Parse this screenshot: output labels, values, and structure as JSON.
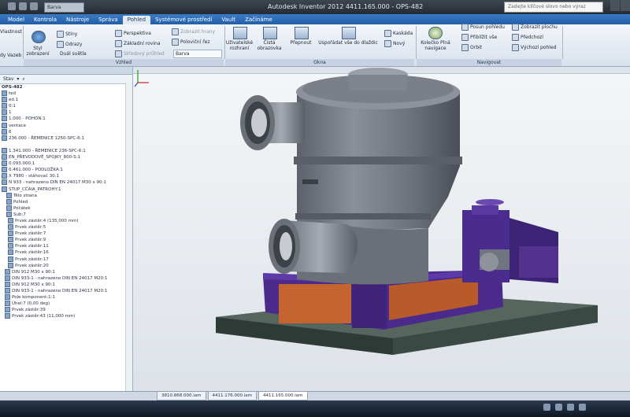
{
  "app": {
    "title": "Autodesk Inventor 2012   4411.165.000 - OPS-482",
    "qat_field": "Barva",
    "help_placeholder": "Zadejte klíčové slovo nebo výraz"
  },
  "tabs": [
    "Model",
    "Kontrola",
    "Nástroje",
    "Správa",
    "Pohled",
    "Systémové prostředí",
    "Vault",
    "Začínáme"
  ],
  "active_tab": "Pohled",
  "ribbon": {
    "styl_label": "Styl zobrazení",
    "stiny": "Stíny",
    "odrazy": "Odrazy",
    "dual_svetla": "Duál světla",
    "perspektiva": "Perspektiva",
    "zakladni_rovina": "Základní rovina",
    "stredovy_pruhled": "Středový průhled",
    "zobrazit_hrany": "Zobrazit hrany",
    "polovicni_rez": "Poloviční řez",
    "barva": "Barva",
    "vzhled_group": "Vzhled",
    "uzivatelske_rozhrani": "Uživatelské rozhraní",
    "cista_obrazovka": "Čistá obrazovka",
    "prepnout": "Přepnout",
    "usporadat": "Uspořádat vše do dlaždic",
    "kaskada": "Kaskáda",
    "novy": "Nový",
    "okna_group": "Okna",
    "kolecko": "Kolečko Plná navigace",
    "posun": "Posun pohledu",
    "priblizit": "Přiblížit vše",
    "orbit": "Orbit",
    "zobrazit_plochu": "Zobrazit plochu",
    "predchozi": "Předchozí",
    "vychozi_pohled": "Výchozí pohled",
    "navigovat_group": "Navigovat",
    "left_cut": "Vlastnost",
    "left_cut2": "dy Vazeb"
  },
  "browser": {
    "header": "Stav",
    "root": "OPS-482",
    "items": [
      "ted",
      "ed.1",
      "0:1",
      "1",
      "1.000 - POHON:1",
      "ventace",
      "6",
      "236.000 - ŘEMENICE 1250-SPC-6:1",
      "",
      "1.341.000 - ŘEMENICE 236-SPC-6:1",
      "EN_PŘEVODOVÉ_SPOJKY_800-S:1",
      "0.093.000:1",
      "0.461.000 - PODLOŽKA:1",
      "X 7980 - stáhovač 30:1",
      "N 933 - nahrazeno DIN EN 24017 M30 x 90:1",
      "STUP_CČAIA_PATROHY:1",
      "Tělo strana",
      "Pohled",
      "Počátek",
      "Sub:7",
      "Prvek zástěr:4 (135,000 mm)",
      "Prvek zástěr:5",
      "Prvek zástěr:7",
      "Prvek zástěr:9",
      "Prvek zástěr:11",
      "Prvek zástěr:16",
      "Prvek zástěr:17",
      "Prvek zástěr:20",
      "DIN 912 M30 x 90:1",
      "DIN 933-1 - nahrazeno DIN EN 24017 M20:1",
      "DIN 912 M30 x 90:1",
      "DIN 933-1 - nahrazeno DIN EN 24017 M20:1",
      "Pole komponent:1:1",
      "Úhel:7 (0,00 deg)",
      "Prvek zástěr:39",
      "Prvek zástěr:43 (11,000 mm)"
    ]
  },
  "doc_tabs": [
    "3810.868.000.iam",
    "4411.176.000.iam",
    "4411.165.000.iam"
  ],
  "active_doc_tab": "4411.165.000.iam",
  "colors": {
    "vessel": "#7b8089",
    "frame": "#4b2a8c",
    "panel_orange": "#c5642f",
    "base": "#3c4a45",
    "ribbon_tab": "#2d6bb5"
  }
}
